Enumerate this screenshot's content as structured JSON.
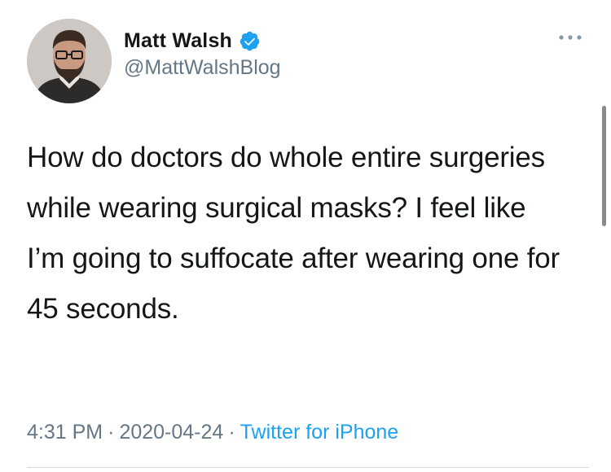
{
  "author": {
    "display_name": "Matt Walsh",
    "handle": "@MattWalshBlog",
    "verified": true,
    "avatar_icon": "profile-photo"
  },
  "tweet": {
    "text": "How do doctors do whole entire surgeries while wearing surgical masks? I feel like I’m going to suffocate after wearing one for 45 seconds.",
    "time": "4:31 PM",
    "date": "2020-04-24",
    "separator": "·",
    "source": "Twitter for iPhone"
  },
  "icons": {
    "verified": "verified-badge-icon",
    "more": "more-options-icon"
  },
  "colors": {
    "text": "#14171a",
    "secondary": "#657786",
    "accent": "#1da1f2",
    "divider": "#cfd9de"
  }
}
